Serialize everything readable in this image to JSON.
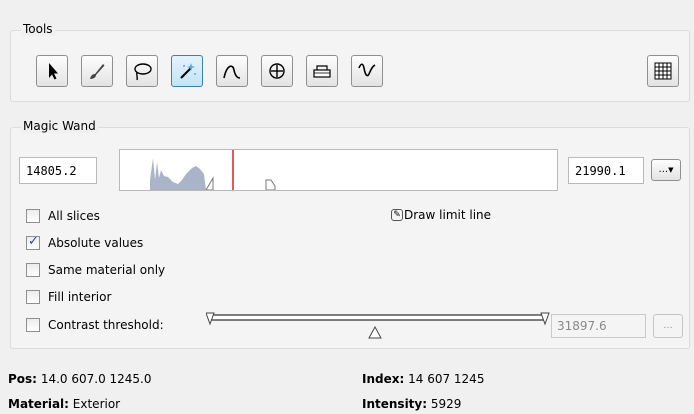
{
  "tools": {
    "title": "Tools",
    "buttons": [
      {
        "name": "select-arrow",
        "icon": "arrow-icon"
      },
      {
        "name": "brush",
        "icon": "brush-icon"
      },
      {
        "name": "lasso",
        "icon": "lasso-icon"
      },
      {
        "name": "magic-wand",
        "icon": "magic-wand-icon",
        "active": true
      },
      {
        "name": "curve",
        "icon": "curve-icon"
      },
      {
        "name": "crosshair",
        "icon": "crosshair-icon"
      },
      {
        "name": "eraser",
        "icon": "eraser-icon"
      },
      {
        "name": "wave",
        "icon": "wave-icon"
      }
    ],
    "grid_button_icon": "grid-icon"
  },
  "wand": {
    "title": "Magic Wand",
    "min_value": "14805.2",
    "max_value": "21990.1",
    "more_label": "...",
    "all_slices": {
      "label": "All slices",
      "checked": false
    },
    "absolute_values": {
      "label": "Absolute values",
      "checked": true
    },
    "same_material": {
      "label": "Same material only",
      "checked": false
    },
    "fill_interior": {
      "label": "Fill interior",
      "checked": false
    },
    "contrast_threshold": {
      "label": "Contrast threshold:",
      "checked": false,
      "value": "31897.6"
    },
    "draw_limit_line": "Draw limit line",
    "more_disabled_label": "..."
  },
  "status": {
    "pos_label": "Pos:",
    "pos_value": "14.0 607.0 1245.0",
    "index_label": "Index:",
    "index_value": "14 607 1245",
    "material_label": "Material:",
    "material_value": "Exterior",
    "intensity_label": "Intensity:",
    "intensity_value": "5929"
  },
  "colors": {
    "histogram": "#aab4c8",
    "limit_line": "#e02020",
    "active_tool": "#c2e4f6"
  }
}
